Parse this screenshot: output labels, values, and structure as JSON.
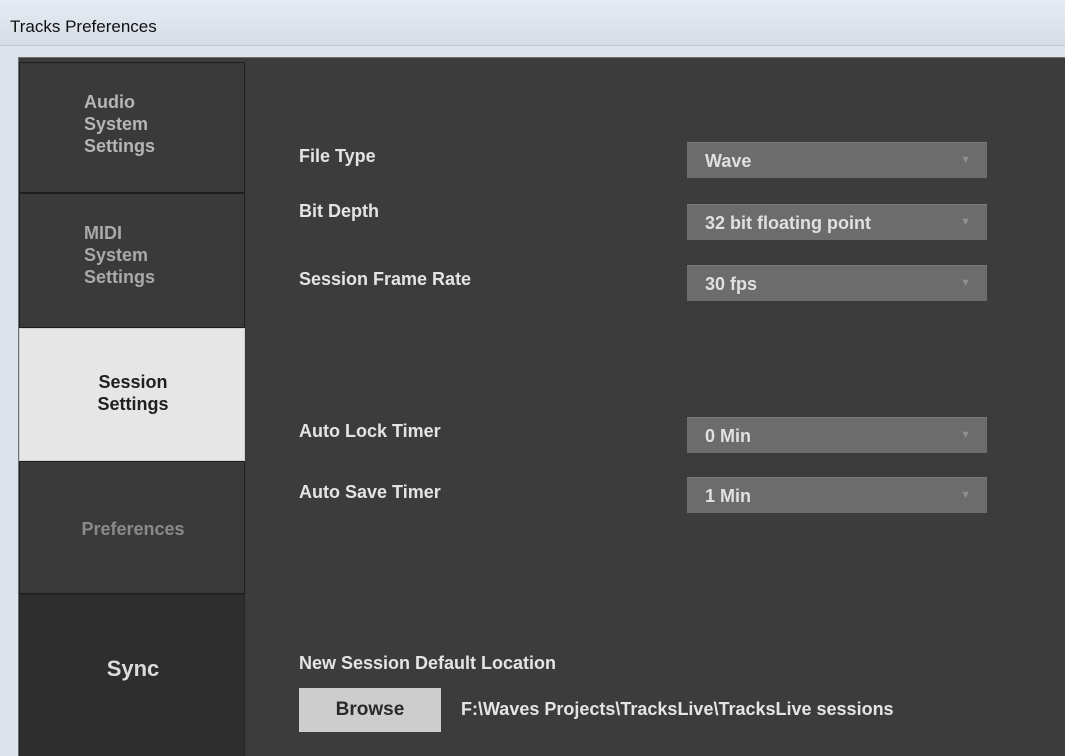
{
  "window": {
    "title": "Tracks Preferences"
  },
  "sidebar": {
    "items": [
      {
        "label_lines": [
          "Audio",
          "System",
          "Settings"
        ]
      },
      {
        "label_lines": [
          "MIDI",
          "System",
          "Settings"
        ]
      },
      {
        "label_lines": [
          "Session",
          "Settings"
        ]
      },
      {
        "label": "Preferences"
      },
      {
        "label": "Sync"
      }
    ],
    "selected": "Session Settings"
  },
  "session": {
    "file_type": {
      "label": "File Type",
      "value": "Wave"
    },
    "bit_depth": {
      "label": "Bit Depth",
      "value": "32 bit floating point"
    },
    "frame_rate": {
      "label": "Session Frame Rate",
      "value": "30 fps"
    },
    "auto_lock": {
      "label": "Auto Lock Timer",
      "value": "0 Min"
    },
    "auto_save": {
      "label": "Auto Save Timer",
      "value": "1 Min"
    },
    "default_location": {
      "label": "New Session Default Location",
      "browse_label": "Browse",
      "path": "F:\\Waves Projects\\TracksLive\\TracksLive sessions"
    }
  },
  "icons": {
    "dropdown_arrow": "chevron-down-icon"
  },
  "colors": {
    "panel_bg": "#3c3c3c",
    "selected_tab_bg": "#e6e6e6",
    "dropdown_bg": "#6c6c6c",
    "button_bg": "#cdcdcd"
  }
}
